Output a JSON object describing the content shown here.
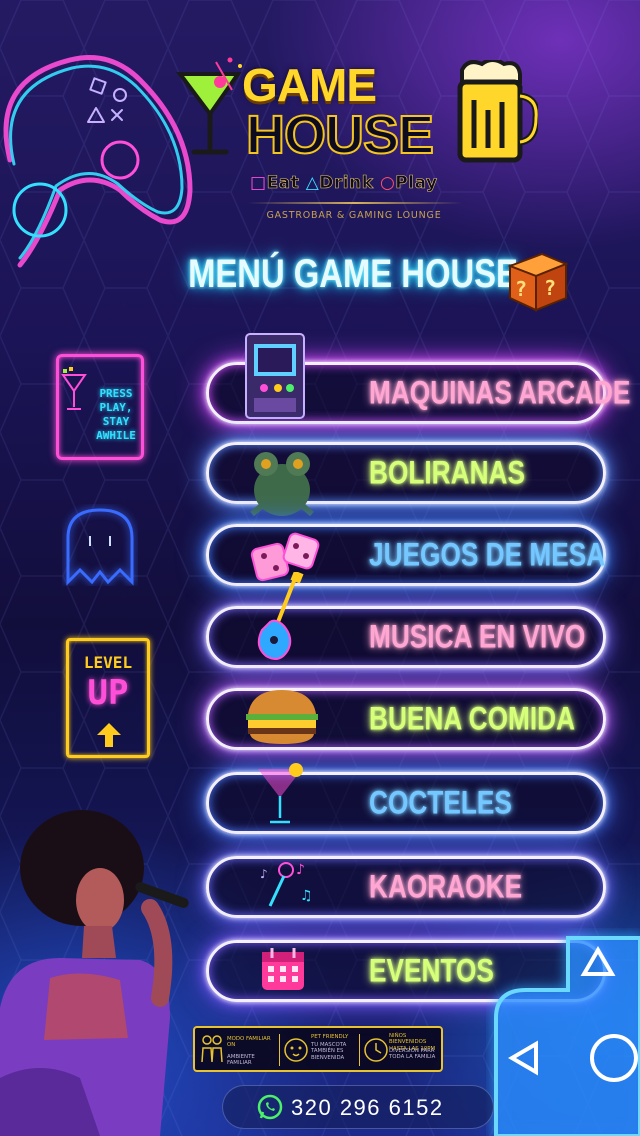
{
  "brand": {
    "name_line1": "GAME",
    "name_line2": "HOUSE",
    "tagline_eat": "Eat",
    "tagline_drink": "Drink",
    "tagline_play": "Play",
    "subtitle": "GASTROBAR & GAMING LOUNGE"
  },
  "title": "MENÚ GAME HOUSE",
  "menu": [
    {
      "label": "MAQUINAS ARCADE",
      "color": "#ffa6d2",
      "glow": "#d64bff",
      "icon": "arcade-machine-icon"
    },
    {
      "label": "BOLIRANAS",
      "color": "#d6ff7a",
      "glow": "#5b8dff",
      "icon": "frog-icon"
    },
    {
      "label": "JUEGOS DE MESA",
      "color": "#74c8ff",
      "glow": "#3f7dff",
      "icon": "dice-icon"
    },
    {
      "label": "MUSICA EN VIVO",
      "color": "#ffa6d2",
      "glow": "#7a6bff",
      "icon": "guitar-icon"
    },
    {
      "label": "BUENA COMIDA",
      "color": "#d6ff7a",
      "glow": "#b45cff",
      "icon": "burger-icon"
    },
    {
      "label": "COCTELES",
      "color": "#74c8ff",
      "glow": "#4b7bff",
      "icon": "cocktail-icon"
    },
    {
      "label": "KAORAOKE",
      "color": "#ffa6d2",
      "glow": "#6a6bff",
      "icon": "microphone-icon"
    },
    {
      "label": "EVENTOS",
      "color": "#d6ff7a",
      "glow": "#7d5bff",
      "icon": "calendar-icon"
    }
  ],
  "signs": {
    "press_play": "PRESS PLAY, STAY AWHILE",
    "level": "LEVEL",
    "up": "UP"
  },
  "footer": {
    "modo_title": "MODO FAMILIAR ON",
    "modo_sub": "AMBIENTE FAMILIAR",
    "pet_title": "PET FRIENDLY",
    "pet_sub": "TU MASCOTA TAMBIÉN ES BIENVENIDA",
    "ninos_title": "NIÑOS BIENVENIDOS HASTA LAS 10PM",
    "ninos_sub": "DIVERSIÓN PARA TODA LA FAMILIA"
  },
  "phone": "320 296 6152",
  "colors": {
    "logo_yellow": "#ffd62a",
    "title_cyan": "#7ef2ff",
    "sign_pink": "#ff4fd8",
    "level_yellow": "#ffcc1e"
  }
}
